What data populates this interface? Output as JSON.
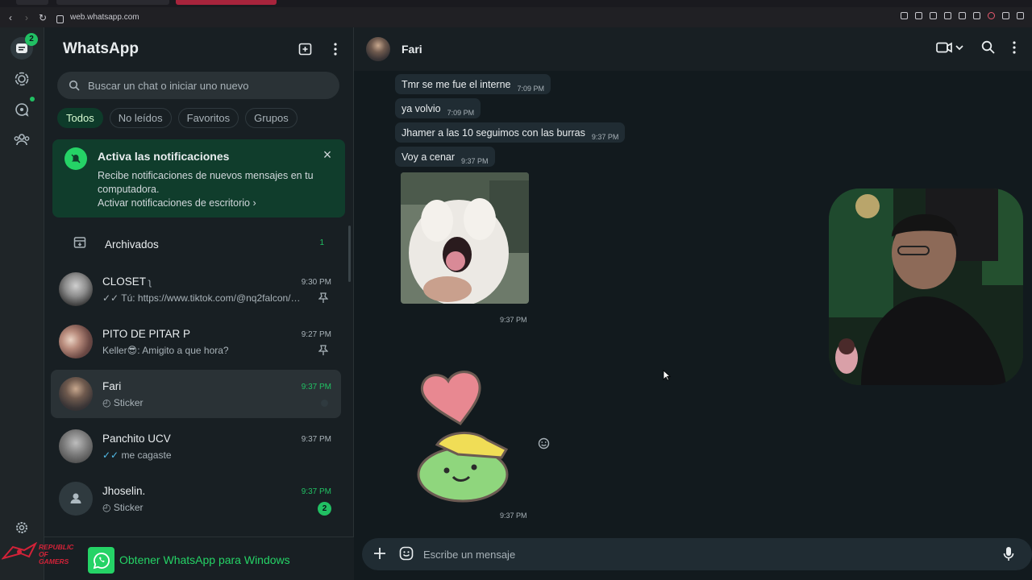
{
  "browser": {
    "url": "web.whatsapp.com"
  },
  "rail": {
    "chats_badge": "2"
  },
  "list": {
    "title": "WhatsApp",
    "search_placeholder": "Buscar un chat o iniciar uno nuevo",
    "filters": [
      "Todos",
      "No leídos",
      "Favoritos",
      "Grupos"
    ],
    "notification": {
      "title": "Activa las notificaciones",
      "body": "Recibe notificaciones de nuevos mensajes en tu computadora.",
      "link": "Activar notificaciones de escritorio"
    },
    "archived": {
      "label": "Archivados",
      "count": "1"
    },
    "chats": [
      {
        "name": "CLOSET",
        "time": "9:30 PM",
        "preview": "Tú: https://www.tiktok.com/@nq2falcon/vide...",
        "pinned": true
      },
      {
        "name": "PITO DE PITAR P",
        "time": "9:27 PM",
        "preview": "Keller😎: Amigito a que hora?",
        "pinned": true
      },
      {
        "name": "Fari",
        "time": "9:37 PM",
        "preview": "Sticker",
        "selected": true
      },
      {
        "name": "Panchito UCV",
        "time": "9:37 PM",
        "preview": "me cagaste"
      },
      {
        "name": "Jhoselin.",
        "time": "9:37 PM",
        "preview": "Sticker",
        "unread": "2"
      }
    ],
    "bottom_cta": "Obtener WhatsApp para Windows"
  },
  "watermark": {
    "line1": "REPUBLIC OF",
    "line2": "GAMERS"
  },
  "conversation": {
    "contact_name": "Fari",
    "messages": [
      {
        "text": "Tmr se me fue el interne",
        "time": "7:09 PM"
      },
      {
        "text": "ya volvio",
        "time": "7:09 PM"
      },
      {
        "text": "Jhamer a las 10 seguimos con las burras",
        "time": "9:37 PM"
      },
      {
        "text": "Voy a cenar",
        "time": "9:37 PM"
      }
    ],
    "image_time": "9:37 PM",
    "sticker_time": "9:37 PM",
    "composer_placeholder": "Escribe un mensaje"
  },
  "colors": {
    "accent": "#21c063",
    "panel": "#181f23",
    "bubble": "#202c33",
    "notification_bg": "#103d2c"
  }
}
